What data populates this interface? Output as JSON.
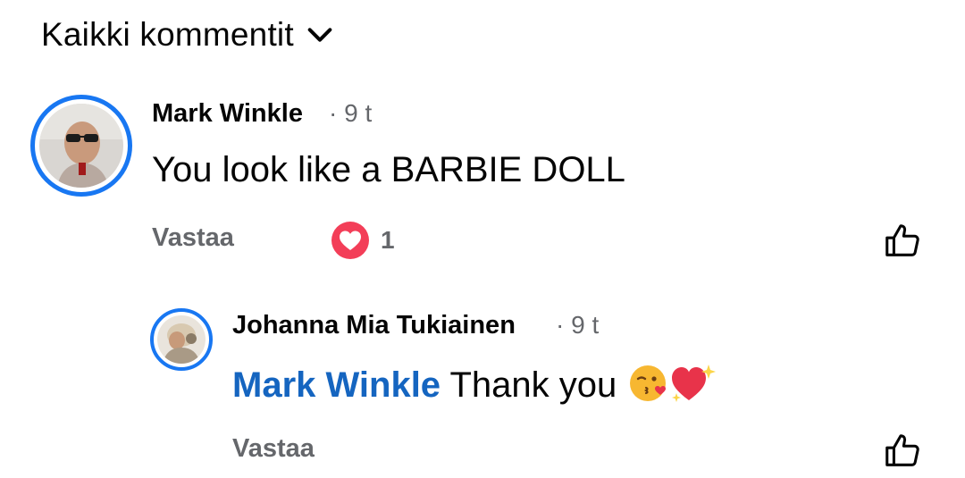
{
  "filter": {
    "label": "Kaikki kommentit",
    "icon": "chevron-down-icon"
  },
  "comments": [
    {
      "author": "Mark Winkle",
      "time": "9 t",
      "text": "You look like a BARBIE DOLL",
      "reply_label": "Vastaa",
      "reaction": {
        "icon": "heart-reaction-icon",
        "count": "1"
      },
      "like_icon": "thumbs-up-icon"
    }
  ],
  "replies": [
    {
      "author": "Johanna Mia Tukiainen",
      "time": "9 t",
      "mention": "Mark Winkle",
      "text": "Thank you",
      "emojis": [
        "kissing-face-heart-emoji",
        "sparkling-heart-emoji"
      ],
      "reply_label": "Vastaa",
      "like_icon": "thumbs-up-icon"
    }
  ],
  "colors": {
    "accent": "#1877f2",
    "mention": "#1565c0",
    "secondary_text": "#65676b",
    "heart": "#f33e58"
  },
  "separator": "·"
}
